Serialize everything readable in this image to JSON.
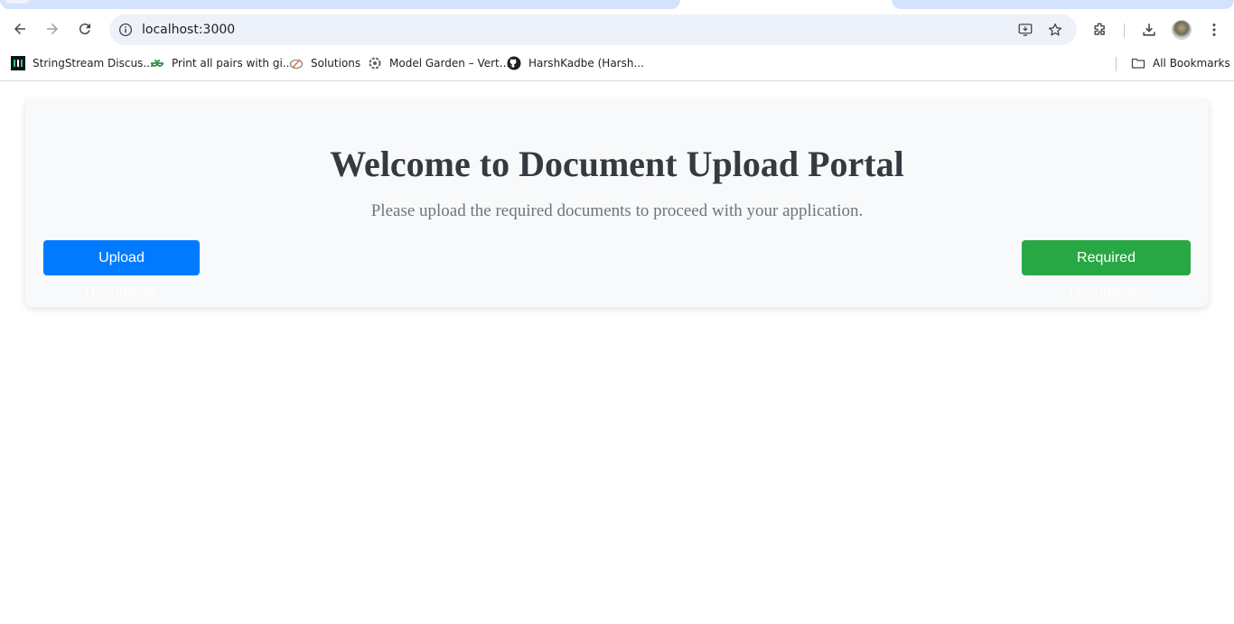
{
  "browser": {
    "url": "localhost:3000",
    "bookmarks": [
      {
        "label": "StringStream Discus...",
        "icon": "hackerrank-icon"
      },
      {
        "label": "Print all pairs with gi...",
        "icon": "geeksforgeeks-icon"
      },
      {
        "label": "Solutions",
        "icon": "solutions-icon"
      },
      {
        "label": "Model Garden – Vert...",
        "icon": "vertex-ai-icon"
      },
      {
        "label": "HarshKadbe (Harsh...",
        "icon": "github-icon"
      }
    ],
    "all_bookmarks_label": "All Bookmarks"
  },
  "page": {
    "title": "Welcome to Document Upload Portal",
    "subtitle": "Please upload the required documents to proceed with your application.",
    "upload_button": "Upload Documents",
    "required_button": "Required Documents"
  },
  "colors": {
    "upload_button_bg": "#007bff",
    "required_button_bg": "#28a745",
    "title_text": "#343a40",
    "subtitle_text": "#6c757d",
    "card_bg": "#f8f9fa"
  }
}
